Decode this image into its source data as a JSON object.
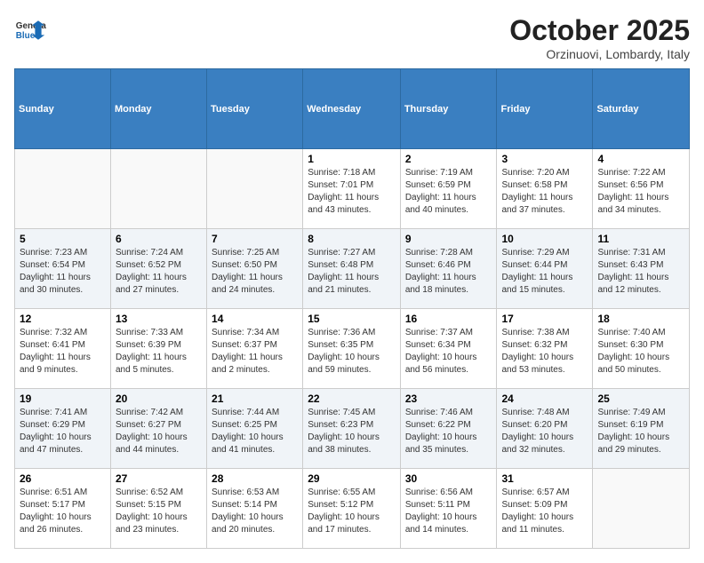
{
  "logo": {
    "general": "General",
    "blue": "Blue"
  },
  "header": {
    "title": "October 2025",
    "subtitle": "Orzinuovi, Lombardy, Italy"
  },
  "days_of_week": [
    "Sunday",
    "Monday",
    "Tuesday",
    "Wednesday",
    "Thursday",
    "Friday",
    "Saturday"
  ],
  "weeks": [
    [
      {
        "num": "",
        "info": ""
      },
      {
        "num": "",
        "info": ""
      },
      {
        "num": "",
        "info": ""
      },
      {
        "num": "1",
        "info": "Sunrise: 7:18 AM\nSunset: 7:01 PM\nDaylight: 11 hours\nand 43 minutes."
      },
      {
        "num": "2",
        "info": "Sunrise: 7:19 AM\nSunset: 6:59 PM\nDaylight: 11 hours\nand 40 minutes."
      },
      {
        "num": "3",
        "info": "Sunrise: 7:20 AM\nSunset: 6:58 PM\nDaylight: 11 hours\nand 37 minutes."
      },
      {
        "num": "4",
        "info": "Sunrise: 7:22 AM\nSunset: 6:56 PM\nDaylight: 11 hours\nand 34 minutes."
      }
    ],
    [
      {
        "num": "5",
        "info": "Sunrise: 7:23 AM\nSunset: 6:54 PM\nDaylight: 11 hours\nand 30 minutes."
      },
      {
        "num": "6",
        "info": "Sunrise: 7:24 AM\nSunset: 6:52 PM\nDaylight: 11 hours\nand 27 minutes."
      },
      {
        "num": "7",
        "info": "Sunrise: 7:25 AM\nSunset: 6:50 PM\nDaylight: 11 hours\nand 24 minutes."
      },
      {
        "num": "8",
        "info": "Sunrise: 7:27 AM\nSunset: 6:48 PM\nDaylight: 11 hours\nand 21 minutes."
      },
      {
        "num": "9",
        "info": "Sunrise: 7:28 AM\nSunset: 6:46 PM\nDaylight: 11 hours\nand 18 minutes."
      },
      {
        "num": "10",
        "info": "Sunrise: 7:29 AM\nSunset: 6:44 PM\nDaylight: 11 hours\nand 15 minutes."
      },
      {
        "num": "11",
        "info": "Sunrise: 7:31 AM\nSunset: 6:43 PM\nDaylight: 11 hours\nand 12 minutes."
      }
    ],
    [
      {
        "num": "12",
        "info": "Sunrise: 7:32 AM\nSunset: 6:41 PM\nDaylight: 11 hours\nand 9 minutes."
      },
      {
        "num": "13",
        "info": "Sunrise: 7:33 AM\nSunset: 6:39 PM\nDaylight: 11 hours\nand 5 minutes."
      },
      {
        "num": "14",
        "info": "Sunrise: 7:34 AM\nSunset: 6:37 PM\nDaylight: 11 hours\nand 2 minutes."
      },
      {
        "num": "15",
        "info": "Sunrise: 7:36 AM\nSunset: 6:35 PM\nDaylight: 10 hours\nand 59 minutes."
      },
      {
        "num": "16",
        "info": "Sunrise: 7:37 AM\nSunset: 6:34 PM\nDaylight: 10 hours\nand 56 minutes."
      },
      {
        "num": "17",
        "info": "Sunrise: 7:38 AM\nSunset: 6:32 PM\nDaylight: 10 hours\nand 53 minutes."
      },
      {
        "num": "18",
        "info": "Sunrise: 7:40 AM\nSunset: 6:30 PM\nDaylight: 10 hours\nand 50 minutes."
      }
    ],
    [
      {
        "num": "19",
        "info": "Sunrise: 7:41 AM\nSunset: 6:29 PM\nDaylight: 10 hours\nand 47 minutes."
      },
      {
        "num": "20",
        "info": "Sunrise: 7:42 AM\nSunset: 6:27 PM\nDaylight: 10 hours\nand 44 minutes."
      },
      {
        "num": "21",
        "info": "Sunrise: 7:44 AM\nSunset: 6:25 PM\nDaylight: 10 hours\nand 41 minutes."
      },
      {
        "num": "22",
        "info": "Sunrise: 7:45 AM\nSunset: 6:23 PM\nDaylight: 10 hours\nand 38 minutes."
      },
      {
        "num": "23",
        "info": "Sunrise: 7:46 AM\nSunset: 6:22 PM\nDaylight: 10 hours\nand 35 minutes."
      },
      {
        "num": "24",
        "info": "Sunrise: 7:48 AM\nSunset: 6:20 PM\nDaylight: 10 hours\nand 32 minutes."
      },
      {
        "num": "25",
        "info": "Sunrise: 7:49 AM\nSunset: 6:19 PM\nDaylight: 10 hours\nand 29 minutes."
      }
    ],
    [
      {
        "num": "26",
        "info": "Sunrise: 6:51 AM\nSunset: 5:17 PM\nDaylight: 10 hours\nand 26 minutes."
      },
      {
        "num": "27",
        "info": "Sunrise: 6:52 AM\nSunset: 5:15 PM\nDaylight: 10 hours\nand 23 minutes."
      },
      {
        "num": "28",
        "info": "Sunrise: 6:53 AM\nSunset: 5:14 PM\nDaylight: 10 hours\nand 20 minutes."
      },
      {
        "num": "29",
        "info": "Sunrise: 6:55 AM\nSunset: 5:12 PM\nDaylight: 10 hours\nand 17 minutes."
      },
      {
        "num": "30",
        "info": "Sunrise: 6:56 AM\nSunset: 5:11 PM\nDaylight: 10 hours\nand 14 minutes."
      },
      {
        "num": "31",
        "info": "Sunrise: 6:57 AM\nSunset: 5:09 PM\nDaylight: 10 hours\nand 11 minutes."
      },
      {
        "num": "",
        "info": ""
      }
    ]
  ]
}
